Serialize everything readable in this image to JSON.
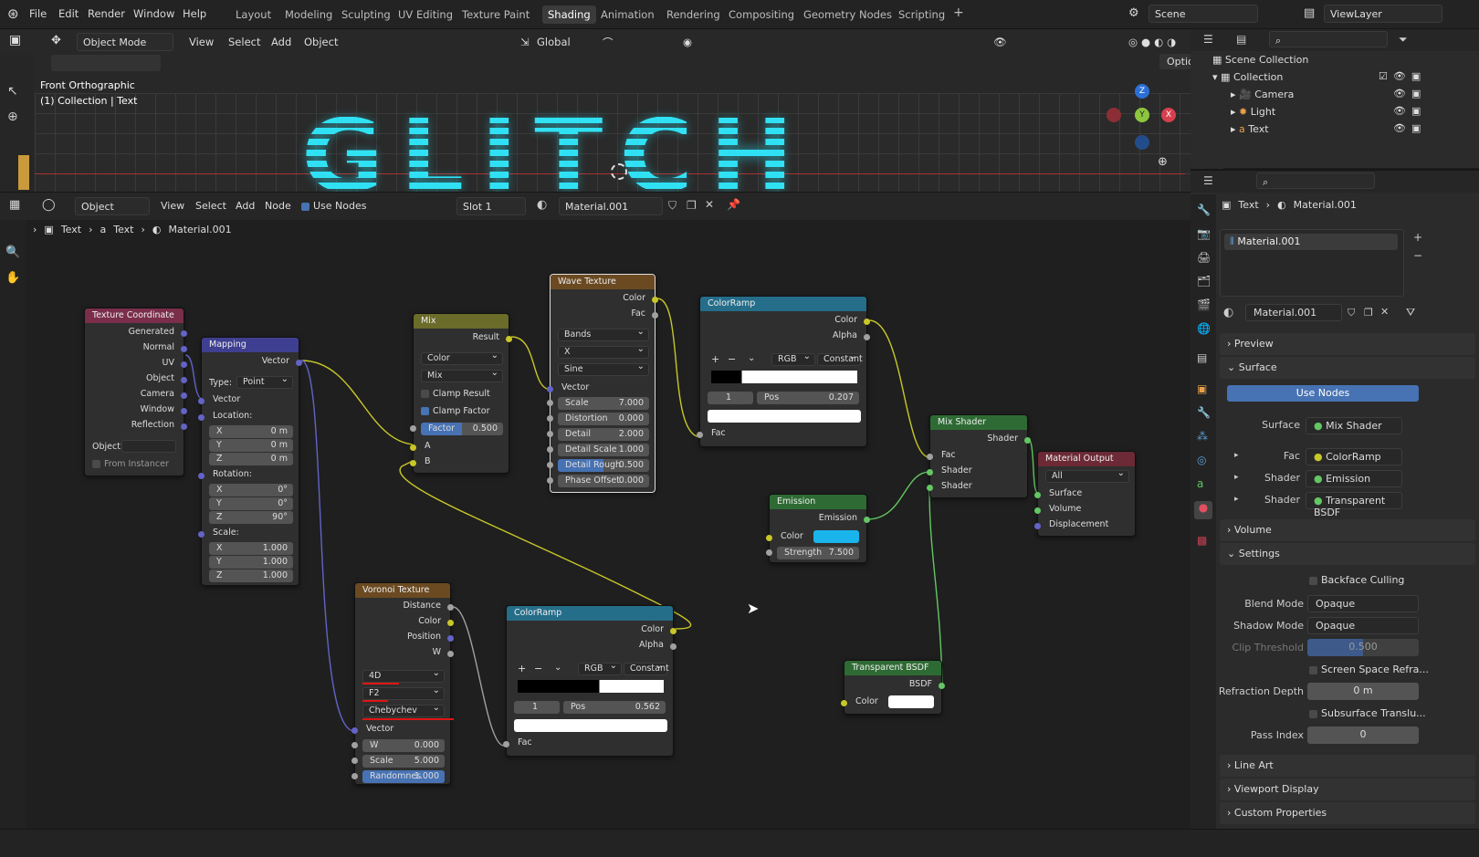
{
  "menu": [
    "File",
    "Edit",
    "Render",
    "Window",
    "Help"
  ],
  "workspaces": [
    "Layout",
    "Modeling",
    "Sculpting",
    "UV Editing",
    "Texture Paint",
    "Shading",
    "Animation",
    "Rendering",
    "Compositing",
    "Geometry Nodes",
    "Scripting"
  ],
  "active_workspace": "Shading",
  "scene": "Scene",
  "view_layer": "ViewLayer",
  "viewport": {
    "mode": "Object Mode",
    "menus": [
      "View",
      "Select",
      "Add",
      "Object"
    ],
    "transform": "Global",
    "options": "Options",
    "view_name": "Front Orthographic",
    "collection_info": "(1) Collection | Text",
    "text": "GLITCH",
    "gizmo": {
      "z": "Z",
      "y": "Y",
      "x": "X"
    }
  },
  "node_editor": {
    "mode": "Object",
    "menus": [
      "View",
      "Select",
      "Add",
      "Node"
    ],
    "use_nodes_label": "Use Nodes",
    "slot": "Slot 1",
    "material": "Material.001",
    "breadcrumb": [
      "Text",
      "Text",
      "Material.001"
    ]
  },
  "nodes": {
    "texcoord": {
      "title": "Texture Coordinate",
      "outputs": [
        "Generated",
        "Normal",
        "UV",
        "Object",
        "Camera",
        "Window",
        "Reflection"
      ],
      "object_label": "Object:",
      "from_instancer": "From Instancer"
    },
    "mapping": {
      "title": "Mapping",
      "out": "Vector",
      "type_label": "Type:",
      "type": "Point",
      "vector": "Vector",
      "location": "Location:",
      "loc": [
        [
          "X",
          "0 m"
        ],
        [
          "Y",
          "0 m"
        ],
        [
          "Z",
          "0 m"
        ]
      ],
      "rotation": "Rotation:",
      "rot": [
        [
          "X",
          "0°"
        ],
        [
          "Y",
          "0°"
        ],
        [
          "Z",
          "90°"
        ]
      ],
      "scale": "Scale:",
      "scl": [
        [
          "X",
          "1.000"
        ],
        [
          "Y",
          "1.000"
        ],
        [
          "Z",
          "1.000"
        ]
      ]
    },
    "mix": {
      "title": "Mix",
      "out": "Result",
      "dtype": "Color",
      "blend": "Mix",
      "clamp_result": "Clamp Result",
      "clamp_factor": "Clamp Factor",
      "factor_k": "Factor",
      "factor_v": "0.500",
      "a": "A",
      "b": "B"
    },
    "wave": {
      "title": "Wave Texture",
      "outs": [
        "Color",
        "Fac"
      ],
      "type": "Bands",
      "dir": "X",
      "profile": "Sine",
      "vector": "Vector",
      "fields": [
        [
          "Scale",
          "7.000"
        ],
        [
          "Distortion",
          "0.000"
        ],
        [
          "Detail",
          "2.000"
        ],
        [
          "Detail Scale",
          "1.000"
        ],
        [
          "Detail Rough",
          "0.500"
        ],
        [
          "Phase Offset",
          "0.000"
        ]
      ]
    },
    "ramp1": {
      "title": "ColorRamp",
      "outs": [
        "Color",
        "Alpha"
      ],
      "mode": "RGB",
      "interp": "Constant",
      "index": "1",
      "pos_k": "Pos",
      "pos_v": "0.207",
      "fac": "Fac"
    },
    "voronoi": {
      "title": "Voronoi Texture",
      "outs": [
        "Distance",
        "Color",
        "Position",
        "W"
      ],
      "dim": "4D",
      "feature": "F2",
      "metric": "Chebychev",
      "vector": "Vector",
      "fields": [
        [
          "W",
          "0.000"
        ],
        [
          "Scale",
          "5.000"
        ],
        [
          "Randomnes",
          "1.000"
        ]
      ]
    },
    "ramp2": {
      "title": "ColorRamp",
      "outs": [
        "Color",
        "Alpha"
      ],
      "mode": "RGB",
      "interp": "Constant",
      "index": "1",
      "pos_k": "Pos",
      "pos_v": "0.562",
      "fac": "Fac"
    },
    "emission": {
      "title": "Emission",
      "out": "Emission",
      "color": "Color",
      "strength_k": "Strength",
      "strength_v": "7.500",
      "swatch": "#1ab4ec"
    },
    "mixshader": {
      "title": "Mix Shader",
      "out": "Shader",
      "ins": [
        "Fac",
        "Shader",
        "Shader"
      ]
    },
    "output": {
      "title": "Material Output",
      "target": "All",
      "ins": [
        "Surface",
        "Volume",
        "Displacement"
      ]
    },
    "transparent": {
      "title": "Transparent BSDF",
      "out": "BSDF",
      "color": "Color"
    }
  },
  "outliner": {
    "root": "Scene Collection",
    "collection": "Collection",
    "items": [
      "Camera",
      "Light",
      "Text"
    ]
  },
  "properties": {
    "breadcrumb": [
      "Text",
      "Material.001"
    ],
    "slot": "Material.001",
    "material": "Material.001",
    "panels": {
      "preview": "Preview",
      "surface": "Surface",
      "volume": "Volume",
      "settings": "Settings",
      "lineart": "Line Art",
      "viewport_display": "Viewport Display",
      "custom_props": "Custom Properties"
    },
    "use_nodes": "Use Nodes",
    "surface_label": "Surface",
    "surface_val": "Mix Shader",
    "fac_label": "Fac",
    "fac_val": "ColorRamp",
    "shader1_label": "Shader",
    "shader1_val": "Emission",
    "shader2_label": "Shader",
    "shader2_val": "Transparent BSDF",
    "backface": "Backface Culling",
    "blend_label": "Blend Mode",
    "blend_val": "Opaque",
    "shadow_label": "Shadow Mode",
    "shadow_val": "Opaque",
    "clip_label": "Clip Threshold",
    "clip_val": "0.500",
    "ssr": "Screen Space Refra...",
    "refr_label": "Refraction Depth",
    "refr_val": "0 m",
    "sss": "Subsurface Translu...",
    "pass_label": "Pass Index",
    "pass_val": "0"
  }
}
